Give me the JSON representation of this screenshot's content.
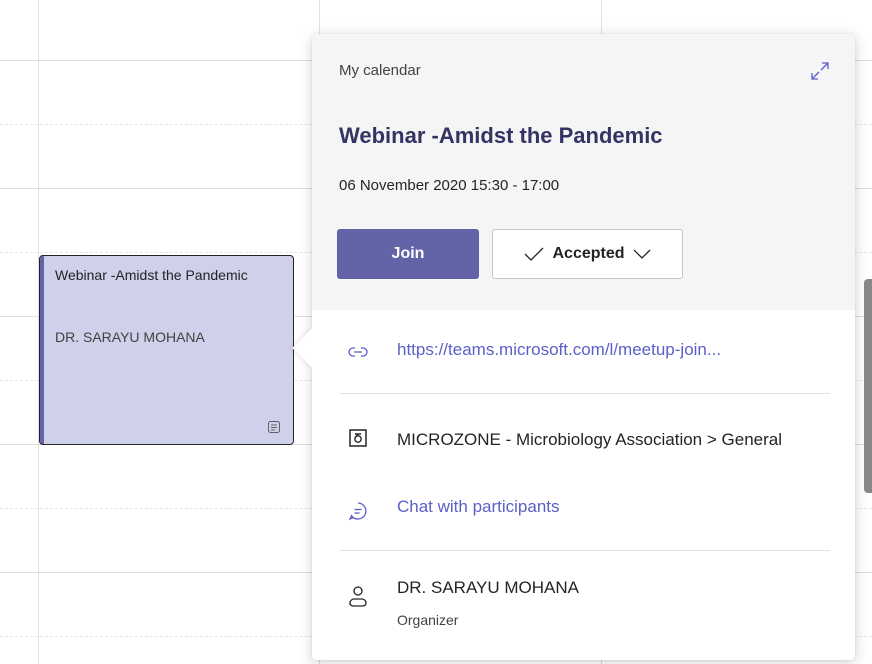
{
  "calendar_event": {
    "title": "Webinar -Amidst the Pandemic",
    "organizer": "DR. SARAYU MOHANA"
  },
  "popup": {
    "calendar_name": "My calendar",
    "title": "Webinar -Amidst the Pandemic",
    "datetime": "06 November 2020 15:30 - 17:00",
    "join_label": "Join",
    "rsvp_label": "Accepted",
    "meeting_link": "https://teams.microsoft.com/l/meetup-join...",
    "channel": "MICROZONE - Microbiology Association > General",
    "chat_label": "Chat with participants",
    "organizer_name": "DR. SARAYU MOHANA",
    "organizer_role": "Organizer"
  },
  "icons": {
    "expand": "expand-icon",
    "link": "link-icon",
    "team": "team-icon",
    "chat": "chat-icon",
    "person": "person-icon",
    "note": "note-icon"
  },
  "colors": {
    "accent": "#6264a7",
    "event_fill": "#cfd0ea",
    "title_text": "#333464",
    "link_text": "#5b5fc7"
  }
}
